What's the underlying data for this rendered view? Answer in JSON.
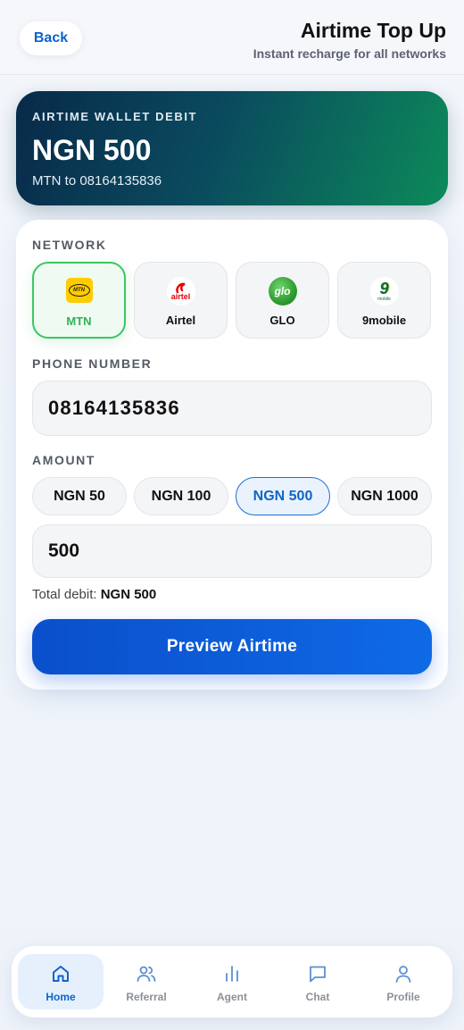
{
  "header": {
    "back_label": "Back",
    "title": "Airtime Top Up",
    "subtitle": "Instant recharge for all networks"
  },
  "wallet": {
    "kicker": "AIRTIME WALLET DEBIT",
    "amount": "NGN 500",
    "summary": "MTN to 08164135836"
  },
  "form": {
    "network_label": "NETWORK",
    "networks": [
      {
        "name": "MTN",
        "logo_text": "MTN",
        "icon": "mtn-logo",
        "selected": true
      },
      {
        "name": "Airtel",
        "logo_text": "airtel",
        "icon": "airtel-logo",
        "selected": false
      },
      {
        "name": "GLO",
        "logo_text": "glo",
        "icon": "glo-logo",
        "selected": false
      },
      {
        "name": "9mobile",
        "logo_text": "9",
        "logo_subtext": "mobile",
        "icon": "9mobile-logo",
        "selected": false
      }
    ],
    "phone_label": "PHONE NUMBER",
    "phone_value": "08164135836",
    "amount_label": "AMOUNT",
    "amount_options": [
      "NGN 50",
      "NGN 100",
      "NGN 500",
      "NGN 1000"
    ],
    "amount_selected": "NGN 500",
    "amount_value": "500",
    "total_prefix": "Total debit:",
    "total_value": "NGN 500",
    "submit_label": "Preview Airtime"
  },
  "nav": {
    "items": [
      {
        "label": "Home",
        "icon": "home-icon",
        "active": true
      },
      {
        "label": "Referral",
        "icon": "users-icon",
        "active": false
      },
      {
        "label": "Agent",
        "icon": "bar-chart-icon",
        "active": false
      },
      {
        "label": "Chat",
        "icon": "chat-icon",
        "active": false
      },
      {
        "label": "Profile",
        "icon": "user-icon",
        "active": false
      }
    ]
  },
  "colors": {
    "accent": "#0f64c8",
    "success": "#3cc565",
    "mtn_yellow": "#ffcc00",
    "airtel_red": "#e40000",
    "glo_green": "#2e9d2e",
    "ninemobile_green": "#0b6b3a"
  }
}
